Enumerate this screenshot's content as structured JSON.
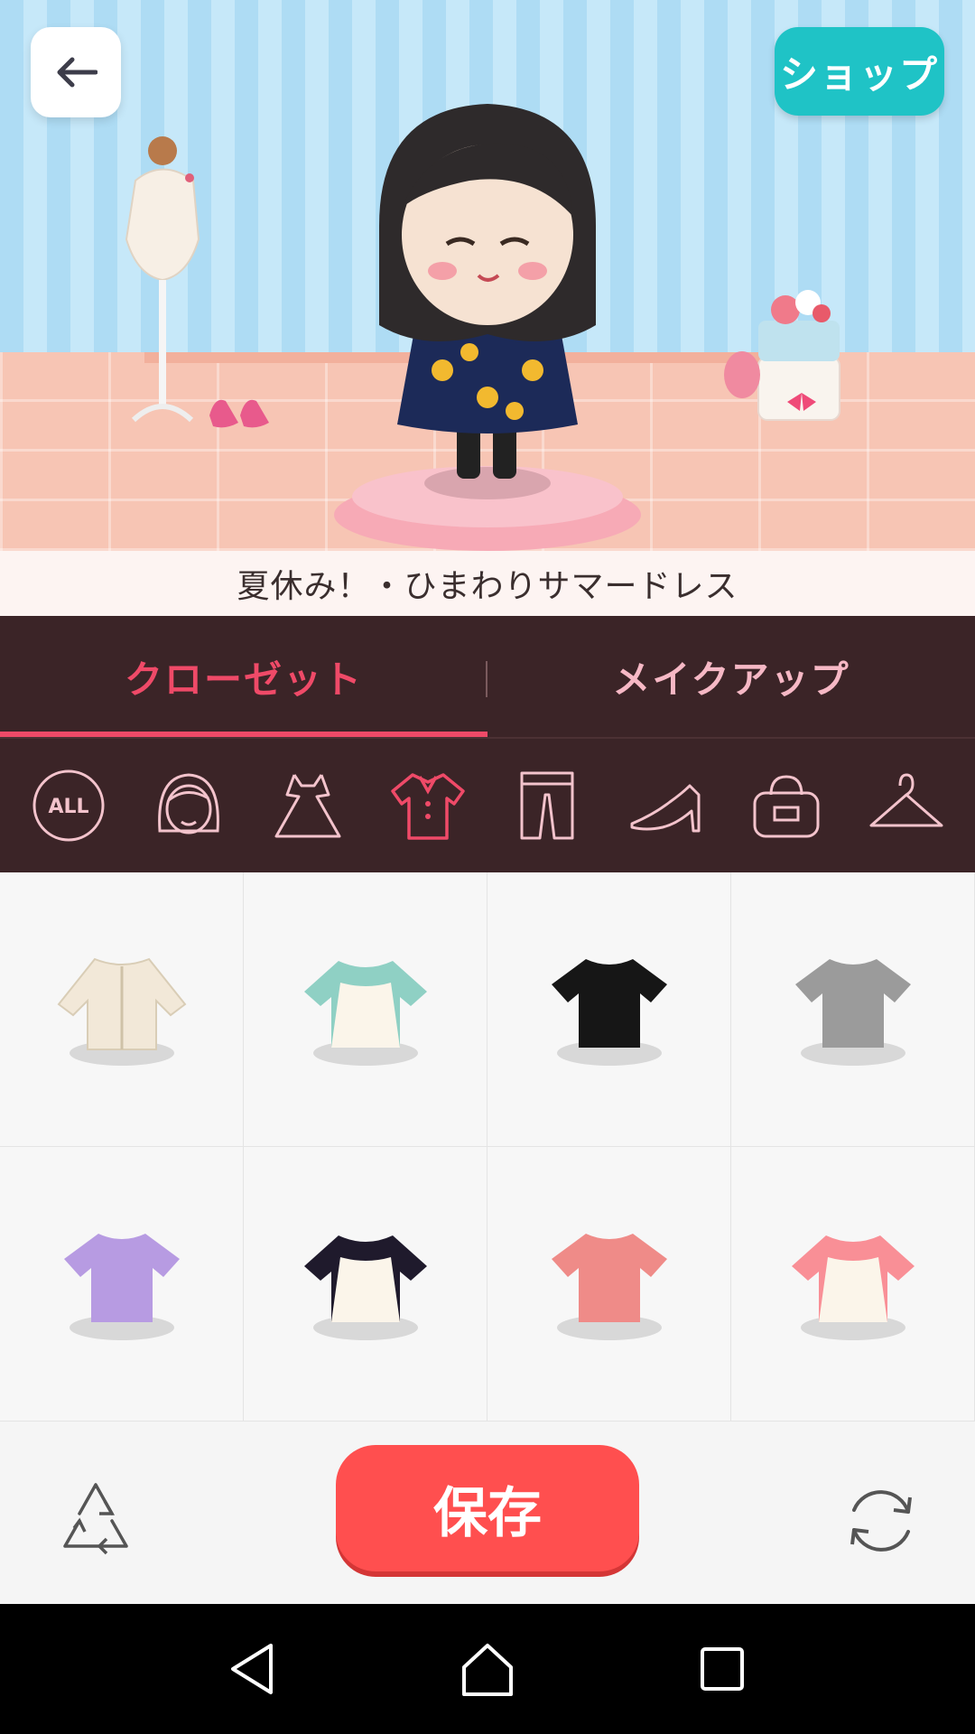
{
  "header": {
    "back_icon": "arrow-left-icon",
    "shop_label": "ショップ"
  },
  "scene": {
    "outfit_name": "夏休み！・ひまわりサマードレス",
    "decor": [
      "mannequin",
      "pink-shoes",
      "gift-box",
      "avatar",
      "pedestal"
    ]
  },
  "tabs": [
    {
      "label": "クローゼット",
      "active": true
    },
    {
      "label": "メイクアップ",
      "active": false
    }
  ],
  "categories": [
    {
      "icon": "all-icon",
      "label": "ALL",
      "active": false
    },
    {
      "icon": "hair-icon",
      "active": false
    },
    {
      "icon": "dress-icon",
      "active": false
    },
    {
      "icon": "top-shirt-icon",
      "active": true
    },
    {
      "icon": "pants-icon",
      "active": false
    },
    {
      "icon": "heel-shoe-icon",
      "active": false
    },
    {
      "icon": "bag-icon",
      "active": false
    },
    {
      "icon": "hanger-icon",
      "active": false
    }
  ],
  "items": [
    {
      "kind": "cardigan",
      "color": "#f2e8d8"
    },
    {
      "kind": "raglan",
      "color": "#8fd0c4"
    },
    {
      "kind": "tshirt",
      "color": "#161616"
    },
    {
      "kind": "tshirt",
      "color": "#9b9b9b"
    },
    {
      "kind": "tshirt",
      "color": "#b79be2"
    },
    {
      "kind": "raglan",
      "color": "#1f1a2c"
    },
    {
      "kind": "tshirt",
      "color": "#ef8b88"
    },
    {
      "kind": "raglan",
      "color": "#f98f96"
    }
  ],
  "footer": {
    "save_label": "保存",
    "recycle_icon": "recycle-icon",
    "refresh_icon": "refresh-icon"
  },
  "colors": {
    "accent": "#ef4a68",
    "save": "#ff4f4f",
    "shop": "#1fc3c6",
    "panel": "#3b2427"
  },
  "system_nav": [
    "back-triangle-icon",
    "home-icon",
    "recents-icon"
  ]
}
